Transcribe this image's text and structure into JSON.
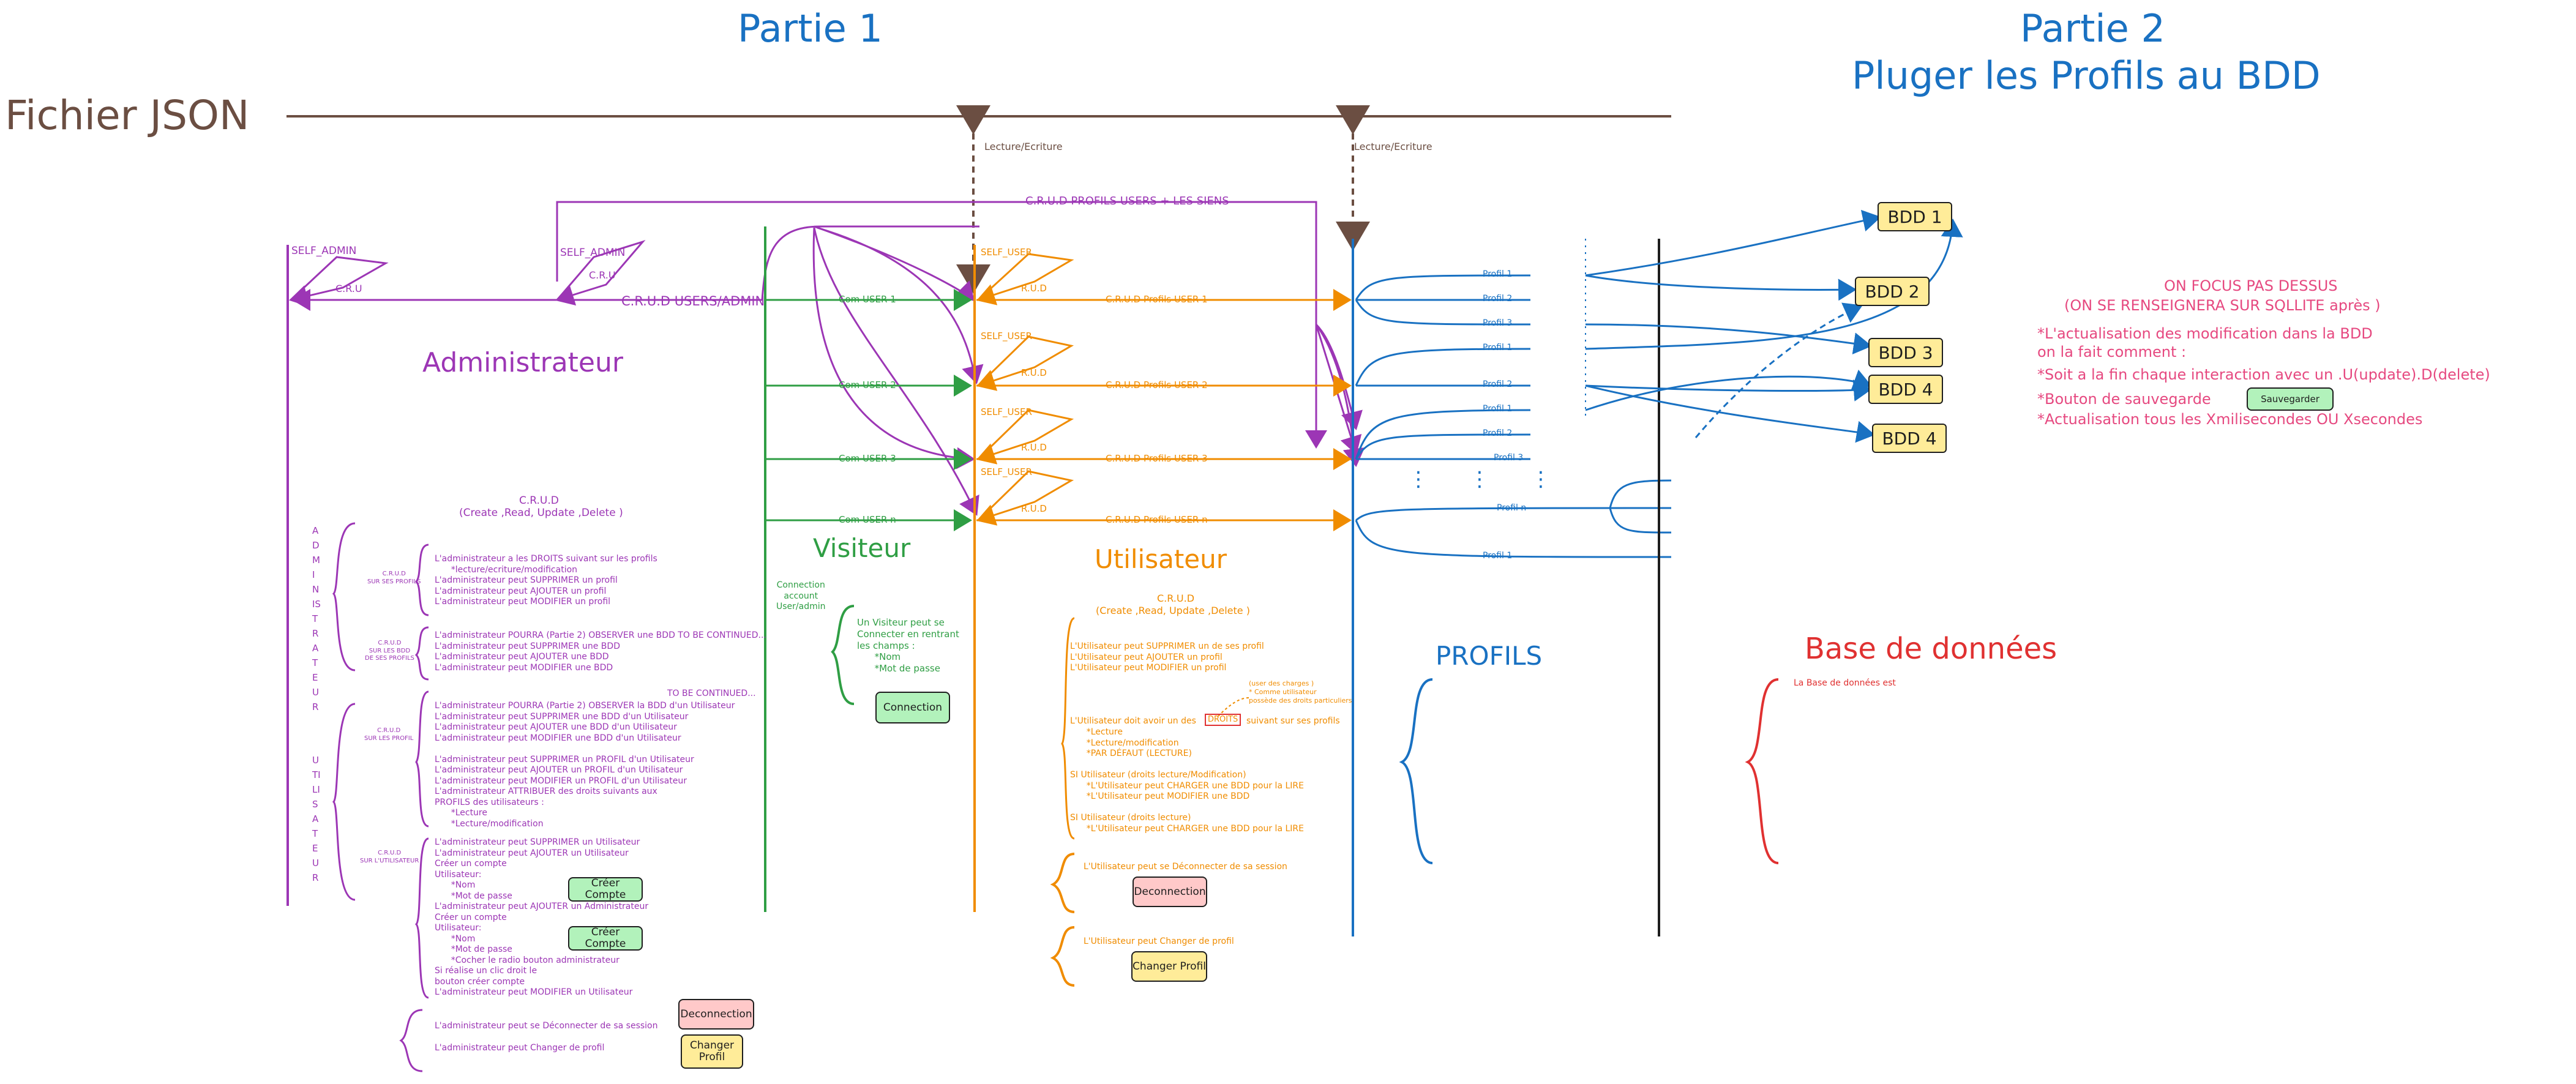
{
  "headings": {
    "partie1": "Partie 1",
    "partie2_line1": "Partie 2",
    "partie2_line2": "Pluger les Profils au BDD",
    "fichier_json": "Fichier JSON",
    "lecture1": "Lecture/Ecriture",
    "lecture2": "Lecture/Ecriture",
    "crud_profils_users": "C.R.U.D PROFILS USERS + LES SIENS",
    "crud_users_admin": "C.R.U.D USERS/ADMIN"
  },
  "admin": {
    "title": "Administrateur",
    "self_admin_1": "SELF_ADMIN",
    "cru_1": "C.R.U",
    "self_admin_2": "SELF_ADMIN",
    "cru_2": "C.R.U",
    "crud_title": "C.R.U.D",
    "crud_subtitle": "(Create ,Read, Update ,Delete )",
    "vertical_admin": "ADMINISTRATEUR",
    "vertical_user": "UTILISATEUR",
    "grp1_label": "C.R.U.D\nSUR SES PROFILS",
    "grp2_label": "C.R.U.D\nSUR LES BDD\nDE SES PROFILS",
    "grp3_label": "C.R.U.D\nSUR LES PROFIL",
    "grp4_label": "C.R.U.D\nSUR L'UTILISATEUR",
    "block1": "L'administrateur a les DROITS suivant sur les profils\n      *lecture/ecriture/modification\nL'administrateur peut SUPPRIMER un profil\nL'administrateur peut AJOUTER un profil\nL'administrateur peut MODIFIER un profil",
    "block2": "L'administrateur POURRA (Partie 2) OBSERVER une BDD TO BE CONTINUED...\nL'administrateur peut SUPPRIMER une BDD\nL'administrateur peut AJOUTER une BDD\nL'administrateur peut MODIFIER une BDD",
    "to_be_continued": "TO BE CONTINUED...",
    "block3": "L'administrateur POURRA (Partie 2) OBSERVER la BDD d'un Utilisateur\nL'administrateur peut SUPPRIMER une BDD d'un Utilisateur\nL'administrateur peut AJOUTER une BDD d'un Utilisateur\nL'administrateur peut MODIFIER une BDD d'un Utilisateur\n\nL'administrateur peut SUPPRIMER un PROFIL d'un Utilisateur\nL'administrateur peut AJOUTER un PROFIL d'un Utilisateur\nL'administrateur peut MODIFIER un PROFIL d'un Utilisateur\nL'administrateur ATTRIBUER des droits suivants aux\nPROFILS des utilisateurs :\n      *Lecture\n      *Lecture/modification",
    "block4": "L'administrateur peut SUPPRIMER un Utilisateur\nL'administrateur peut AJOUTER un Utilisateur\nCréer un compte\nUtilisateur:\n      *Nom\n      *Mot de passe\nL'administrateur peut AJOUTER un Administrateur\nCréer un compte\nUtilisateur:\n      *Nom\n      *Mot de passe\n      *Cocher le radio bouton administrateur\nSi réalise un clic droit le\nbouton créer compte\nL'administrateur peut MODIFIER un Utilisateur",
    "creer_compte_1": "Créer Compte",
    "creer_compte_2": "Créer Compte",
    "deconnect_text": "L'administrateur peut se Déconnecter de sa session",
    "change_text": "L'administrateur peut Changer de profil",
    "deconnection_btn": "Deconnection",
    "changer_profil_btn": "Changer\nProfil"
  },
  "visiteur": {
    "title": "Visiteur",
    "com_user_1": "Com USER 1",
    "com_user_2": "Com USER 2",
    "com_user_3": "Com USER 3",
    "com_user_n": "Com USER n",
    "connection_label": "Connection\naccount\nUser/admin",
    "desc": "Un Visiteur peut se\nConnecter en rentrant\nles champs :\n      *Nom\n      *Mot de passe",
    "connection_btn": "Connection"
  },
  "utilisateur": {
    "title": "Utilisateur",
    "self_user_1": "SELF_USER",
    "rud_1": "R.U.D",
    "self_user_2": "SELF_USER",
    "rud_2": "R.U.D",
    "self_user_3": "SELF_USER",
    "rud_3": "R.U.D",
    "self_user_4": "SELF_USER",
    "rud_4": "R.U.D",
    "crud_profils_1": "C.R.U.D Profils USER 1",
    "crud_profils_2": "C.R.U.D Profils USER 2",
    "crud_profils_3": "C.R.U.D Profils USER 3",
    "crud_profils_n": "C.R.U.D Profils USER n",
    "crud_title": "C.R.U.D",
    "crud_subtitle": "(Create ,Read, Update ,Delete )",
    "block1": "L'Utilisateur peut SUPPRIMER un de ses profil\nL'Utilisateur peut AJOUTER un profil\nL'Utilisateur peut MODIFIER un profil",
    "note": "(user des charges )\n* Comme utilisateur\npossède des droits particuliers",
    "droits_line_a": "L'Utilisateur doit avoir un des",
    "droits_badge": "DROITS",
    "droits_line_b": "suivant sur ses profils",
    "droits_list": "      *Lecture\n      *Lecture/modification\n      *PAR DÉFAUT (LECTURE)",
    "block3": "SI Utilisateur (droits lecture/Modification)\n      *L'Utilisateur peut CHARGER une BDD pour la LIRE\n      *L'Utilisateur peut MODIFIER une BDD\n\nSI Utilisateur (droits lecture)\n      *L'Utilisateur peut CHARGER une BDD pour la LIRE",
    "deconnect_text": "L'Utilisateur peut se Déconnecter de sa session",
    "deconnection_btn": "Deconnection",
    "change_text": "L'Utilisateur peut Changer de profil",
    "changer_profil_btn": "Changer Profil"
  },
  "profils": {
    "title": "PROFILS",
    "p1": "Profil 1",
    "p2": "Profil 2",
    "p3": "Profil 3",
    "p4": "Profil 1",
    "p5": "Profil 2",
    "p6": "Profil 1",
    "p7": "Profil 2",
    "p8": "Profil 3",
    "p9": "Profil n",
    "p10": "Profil 1",
    "dots": "⋮"
  },
  "bdd": {
    "b1": "BDD 1",
    "b2": "BDD 2",
    "b3": "BDD 3",
    "b4": "BDD 4",
    "b5": "BDD 4",
    "title": "Base de données",
    "desc": "La Base de données est"
  },
  "focus": {
    "line1": "ON FOCUS PAS DESSUS",
    "line2": "(ON SE RENSEIGNERA SUR SQLLITE après )",
    "body1": "*L'actualisation des modification dans la BDD\non la fait comment :",
    "body2": "*Soit a la fin chaque interaction avec un .U(update).D(delete)",
    "body3": "*Bouton de sauvegarde",
    "save_btn": "Sauvegarder",
    "body4": "*Actualisation tous les Xmilisecondes OU Xsecondes"
  },
  "colors": {
    "purple": "#9c36b5",
    "green": "#2f9e44",
    "orange": "#f08c00",
    "blue": "#1971c2",
    "red": "#e03131",
    "brown": "#6b4e42",
    "pink": "#e64980",
    "bdd_fill": "#ffec99",
    "green_fill": "#b2f2bb",
    "red_fill": "#ffc9c9"
  }
}
